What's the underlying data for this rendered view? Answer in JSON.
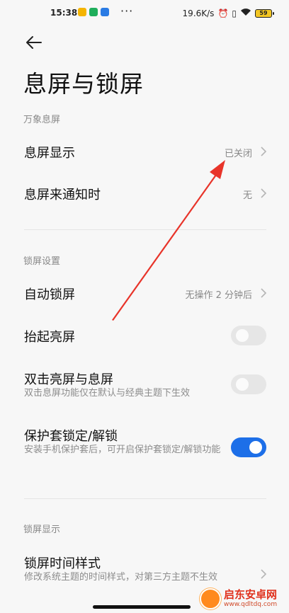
{
  "status_bar": {
    "time": "15:38",
    "more": "···",
    "net_speed": "19.6K/s",
    "battery": "59"
  },
  "header": {
    "title": "息屏与锁屏"
  },
  "sections": {
    "aod": {
      "label": "万象息屏",
      "display": {
        "title": "息屏显示",
        "value": "已关闭"
      },
      "notify": {
        "title": "息屏来通知时",
        "value": "无"
      }
    },
    "lock": {
      "label": "锁屏设置",
      "auto_lock": {
        "title": "自动锁屏",
        "value": "无操作 2 分钟后"
      },
      "raise_wake": {
        "title": "抬起亮屏",
        "on": false
      },
      "double_tap": {
        "title": "双击亮屏与息屏",
        "subtitle": "双击息屏功能仅在默认与经典主题下生效",
        "on": false
      },
      "cover_lock": {
        "title": "保护套锁定/解锁",
        "subtitle": "安装手机保护套后，可开启保护套锁定/解锁功能",
        "on": true
      }
    },
    "lock_display": {
      "label": "锁屏显示",
      "clock_style": {
        "title": "锁屏时间样式",
        "subtitle": "修改系统主题的时间样式，对第三方主题不生效"
      }
    }
  },
  "watermark": {
    "name": "启东安卓网",
    "url": "www.qdltdq.com"
  },
  "colors": {
    "accent": "#1d6fe8",
    "annotation_arrow": "#e8342a"
  }
}
